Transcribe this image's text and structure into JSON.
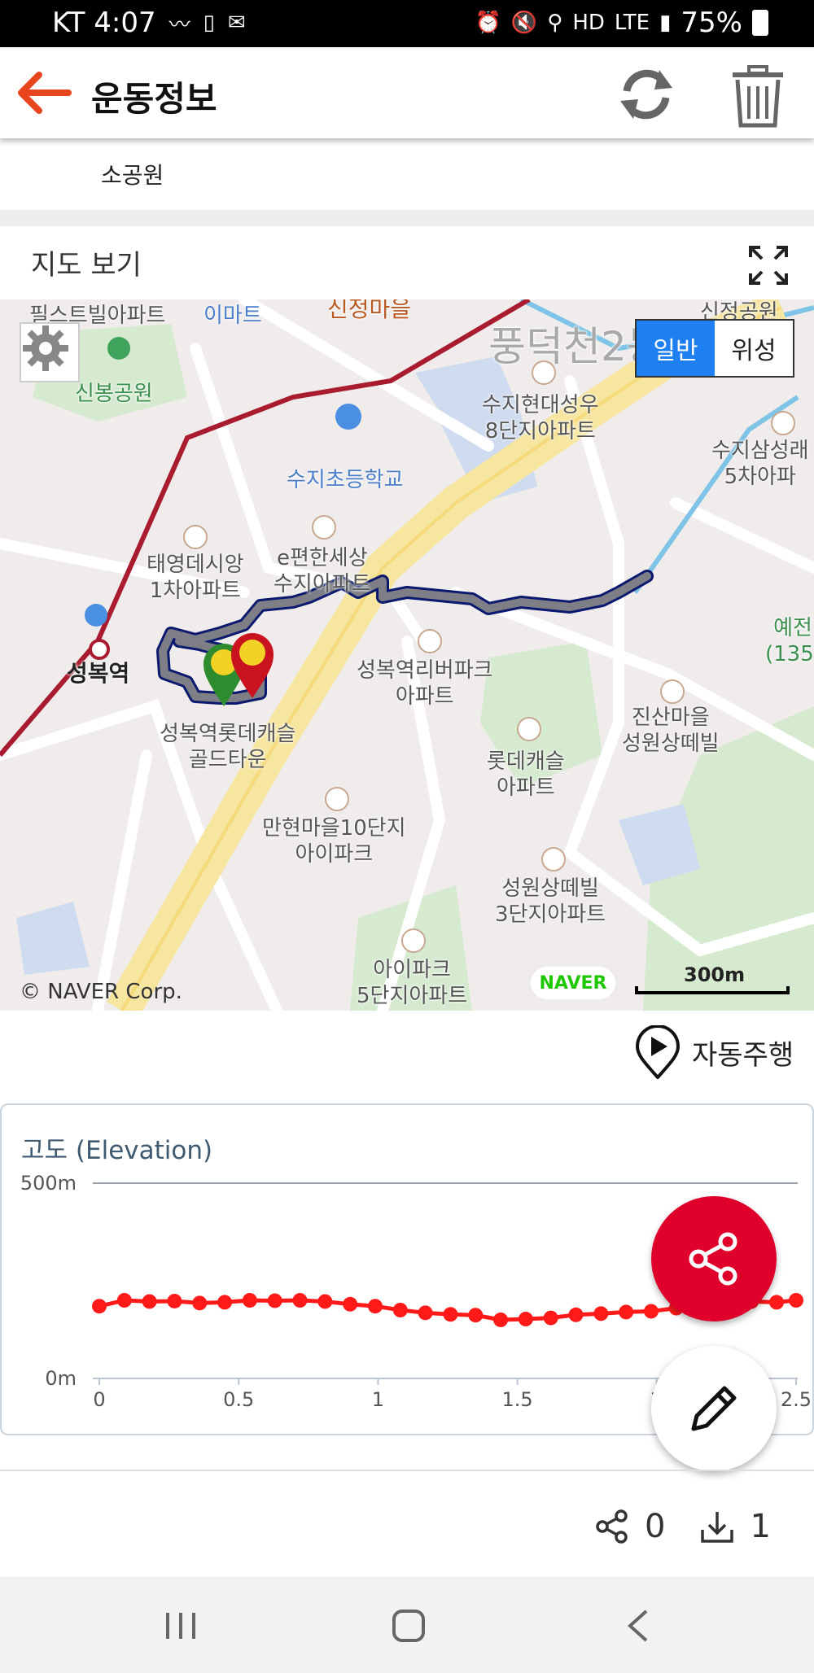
{
  "status_bar": {
    "carrier_time": "KT 4:07",
    "battery": "75%",
    "icons": [
      "wind-icon",
      "lte-sim-icon",
      "mail-icon",
      "alarm-icon",
      "mute-icon",
      "location-icon",
      "hd-icon",
      "lte-icon",
      "signal-icon",
      "battery-icon"
    ]
  },
  "header": {
    "title": "운동정보",
    "icons": [
      "back-arrow-icon",
      "refresh-icon",
      "trash-icon"
    ]
  },
  "place_name": "소공원",
  "map_section": {
    "title": "지도 보기",
    "map_types": [
      "일반",
      "위성"
    ],
    "selected_map_type": "일반",
    "copyright": "© NAVER Corp.",
    "provider": "NAVER",
    "scale": "300m",
    "labels": {
      "l1": "신정마을",
      "l2": "이마트",
      "l3": "풍덕천2동",
      "l4": "신봉공원",
      "l5": "수지현대성우",
      "l5b": "8단지아파트",
      "l6": "수지초등학교",
      "l7": "수지삼성래",
      "l7b": "5차아파",
      "l8": "태영데시앙",
      "l8b": "1차아파트",
      "l9": "e편한세상",
      "l9b": "수지아파트",
      "l10": "성복역",
      "l11": "성복역리버파크",
      "l11b": "아파트",
      "l12": "예전",
      "l12b": "(135.",
      "l13": "성복역롯데캐슬",
      "l13b": "골드타운",
      "l14": "진산마을",
      "l14b": "성원상떼빌",
      "l15": "롯데캐슬",
      "l15b": "아파트",
      "l16": "만현마을10단지",
      "l16b": "아이파크",
      "l17": "성원상떼빌",
      "l17b": "3단지아파트",
      "l18": "아이파크",
      "l18b": "5단지아파트",
      "l19": "신정공원",
      "l20": "필스트빌아파트"
    },
    "markers": {
      "start": "S",
      "goal": "G"
    }
  },
  "auto_drive": {
    "label": "자동주행",
    "icon": "play-pin-icon"
  },
  "elevation": {
    "title": "고도 (Elevation)"
  },
  "chart_data": {
    "type": "line",
    "title": "고도 (Elevation)",
    "xlabel": "",
    "ylabel": "",
    "y_ticks": [
      "500m",
      "0m"
    ],
    "x_ticks": [
      "0",
      "0.5",
      "1",
      "1.5",
      "2",
      "2.5"
    ],
    "xlim": [
      0,
      2.5
    ],
    "ylim": [
      0,
      500
    ],
    "series": [
      {
        "color": "#ff1a1a",
        "x": [
          0,
          0.09,
          0.18,
          0.27,
          0.36,
          0.45,
          0.54,
          0.63,
          0.72,
          0.81,
          0.9,
          0.99,
          1.08,
          1.17,
          1.26,
          1.35,
          1.44,
          1.53,
          1.62,
          1.71,
          1.8,
          1.89,
          1.98,
          2.07,
          2.16,
          2.25,
          2.34,
          2.43,
          2.5
        ],
        "y": [
          185,
          200,
          197,
          198,
          193,
          195,
          200,
          199,
          200,
          197,
          190,
          185,
          175,
          168,
          164,
          162,
          150,
          152,
          155,
          163,
          166,
          170,
          172,
          180,
          188,
          192,
          197,
          195,
          200
        ]
      }
    ],
    "grid": false
  },
  "fab": {
    "share_icon": "share-icon",
    "edit_icon": "pencil-icon"
  },
  "stats": {
    "shares": "0",
    "downloads": "1"
  },
  "nav_bar": {
    "icons": [
      "recent-apps-icon",
      "home-icon",
      "back-icon"
    ]
  }
}
